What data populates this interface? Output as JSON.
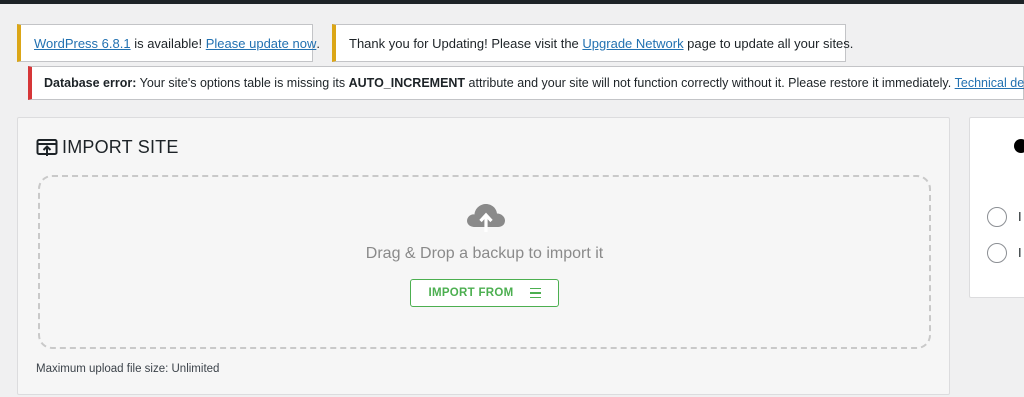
{
  "notices": {
    "update": {
      "link": "WordPress 6.8.1",
      "middle": " is available! ",
      "link2": "Please update now",
      "end": "."
    },
    "upgrade": {
      "prefix": "Thank you for Updating! Please visit the ",
      "link": "Upgrade Network",
      "suffix": " page to update all your sites."
    },
    "db_error": {
      "label": "Database error:",
      "text1": " Your site's options table is missing its ",
      "code": "AUTO_INCREMENT",
      "text2": " attribute and your site will not function correctly without it. Please restore it immediately. ",
      "link": "Technical details"
    }
  },
  "import": {
    "title": "IMPORT SITE",
    "drag_text": "Drag & Drop a backup to import it",
    "button_label": "IMPORT FROM",
    "max_upload": "Maximum upload file size: Unlimited"
  },
  "side": {
    "option1_label": "I",
    "option2_label": "I"
  },
  "colors": {
    "accent_green": "#4caf50",
    "link": "#2271b1",
    "warning": "#dba617",
    "error": "#d63638"
  },
  "icons": [
    "import-icon",
    "cloud-upload-icon",
    "menu-icon"
  ]
}
